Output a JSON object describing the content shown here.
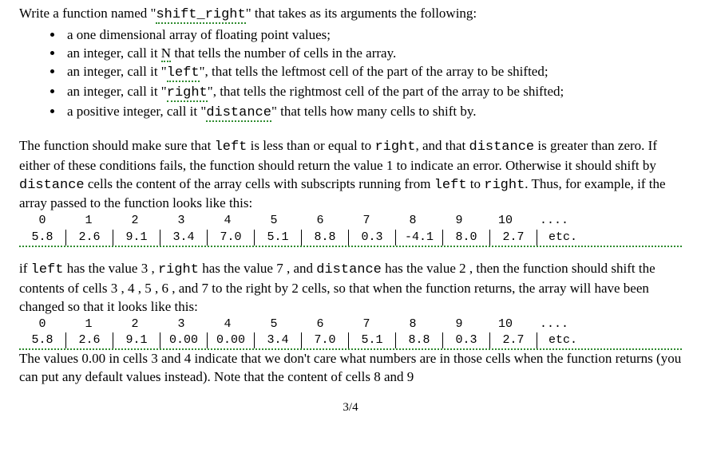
{
  "intro": {
    "part1": "Write a function named \"",
    "fnname": "shift_right",
    "part2": "\" that takes as its arguments the following:"
  },
  "bullets": {
    "b1": "a one dimensional array of floating point values;",
    "b2a": "an integer, call it ",
    "b2N": "N",
    "b2b": " that tells the number of cells in the array.",
    "b3a": "an integer, call it \"",
    "b3code": "left",
    "b3b": "\", that tells the leftmost cell of the part of the array to be shifted;",
    "b4a": "an integer, call it \"",
    "b4code": "right",
    "b4b": "\", that tells the rightmost cell of the part of the array to be shifted;",
    "b5a": "a positive integer, call it \"",
    "b5code": "distance",
    "b5b": "\" that tells how many cells to shift by."
  },
  "p2": {
    "a": "The function should make sure that ",
    "left": "left",
    "b": " is less than or equal to ",
    "right": "right",
    "c": ", and that ",
    "dist": "distance",
    "d": " is greater than zero. If either of these conditions fails, the function should return the value 1 to indicate an error. Otherwise it should shift by ",
    "dist2": "distance",
    "e": " cells the content of the array cells with subscripts running from ",
    "left2": "left",
    "f": " to ",
    "right2": "right",
    "g": ". Thus, for example, if the array passed to the function looks like this:"
  },
  "arr1": {
    "idx": [
      "0",
      "1",
      "2",
      "3",
      "4",
      "5",
      "6",
      "7",
      "8",
      "9",
      "10",
      "...."
    ],
    "vals": [
      "5.8",
      "2.6",
      "9.1",
      "3.4",
      "7.0",
      "5.1",
      "8.8",
      "0.3",
      "-4.1",
      "8.0",
      "2.7",
      "etc."
    ]
  },
  "p3": {
    "a": "if ",
    "left": "left",
    "b": " has the value 3 , ",
    "right": "right",
    "c": " has the value 7 , and ",
    "dist": "distance",
    "d": " has the value 2 , then the function should shift the contents of cells 3 , 4 , 5 , 6 , and 7 to the right by 2 cells, so that when the function returns, the array will have been changed so that it looks like this:"
  },
  "arr2": {
    "idx": [
      "0",
      "1",
      "2",
      "3",
      "4",
      "5",
      "6",
      "7",
      "8",
      "9",
      "10",
      "...."
    ],
    "vals": [
      "5.8",
      "2.6",
      "9.1",
      "0.00",
      "0.00",
      "3.4",
      "7.0",
      "5.1",
      "8.8",
      "0.3",
      "2.7",
      "etc."
    ]
  },
  "p4": "The values 0.00 in cells 3 and 4 indicate that we don't care what numbers are in those cells when the function returns (you can put any default values instead). Note that the content of cells 8 and 9",
  "footer": "3/4"
}
